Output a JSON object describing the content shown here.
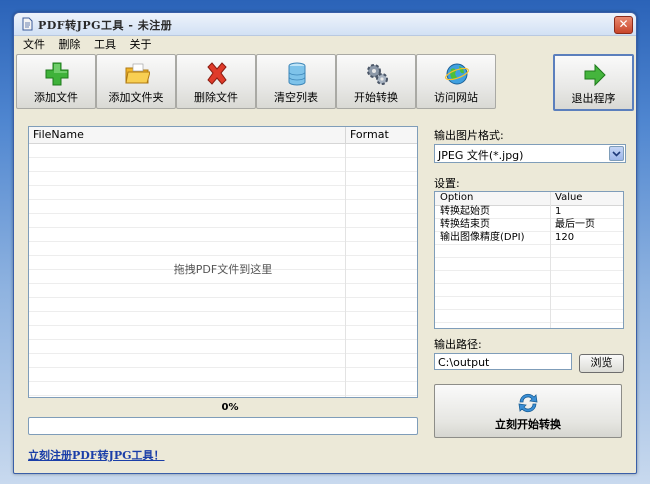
{
  "window": {
    "title": "PDF转JPG工具 - 未注册",
    "close_label": "✕"
  },
  "menu": [
    "文件",
    "删除",
    "工具",
    "关于"
  ],
  "toolbar": [
    {
      "label": "添加文件",
      "icon": "add-file-icon"
    },
    {
      "label": "添加文件夹",
      "icon": "folder-icon"
    },
    {
      "label": "删除文件",
      "icon": "delete-icon"
    },
    {
      "label": "清空列表",
      "icon": "clear-list-icon"
    },
    {
      "label": "开始转换",
      "icon": "gears-icon"
    },
    {
      "label": "访问网站",
      "icon": "globe-icon"
    }
  ],
  "exit_label": "退出程序",
  "file_list": {
    "columns": [
      "FileName",
      "Format"
    ],
    "drop_hint": "拖拽PDF文件到这里"
  },
  "progress": {
    "text": "0%",
    "value": 0
  },
  "register_link": "立刻注册PDF转JPG工具！",
  "output_format": {
    "label": "输出图片格式:",
    "value": "JPEG 文件(*.jpg)"
  },
  "settings": {
    "label": "设置:",
    "columns": [
      "Option",
      "Value"
    ],
    "rows": [
      {
        "option": "转换起始页",
        "value": "1"
      },
      {
        "option": "转换结束页",
        "value": "最后一页"
      },
      {
        "option": "输出图像精度(DPI)",
        "value": "120"
      }
    ]
  },
  "output_path": {
    "label": "输出路径:",
    "value": "C:\\output",
    "browse_label": "浏览"
  },
  "convert_label": "立刻开始转换",
  "colors": {
    "accent": "#4b7fd0",
    "link": "#1a3ea8",
    "window_bg": "#ece9d8"
  }
}
